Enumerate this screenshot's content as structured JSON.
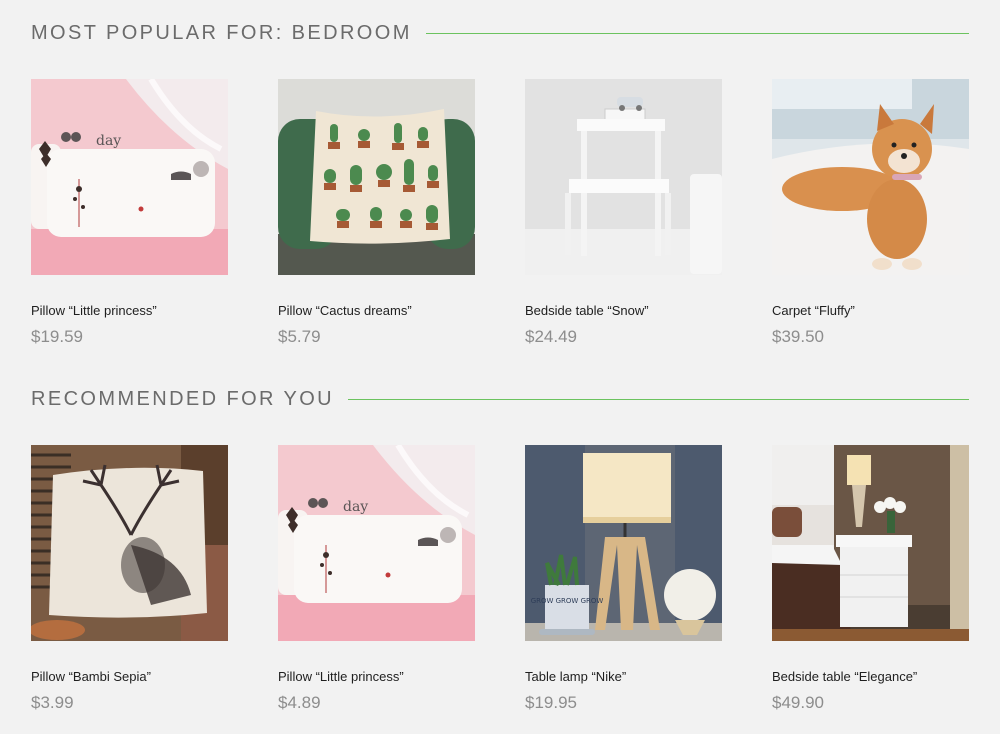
{
  "sections": [
    {
      "title": "MOST POPULAR FOR: BEDROOM",
      "products": [
        {
          "name": "Pillow “Little princess”",
          "price": "$19.59",
          "image": "pillow-princess-image"
        },
        {
          "name": "Pillow “Cactus dreams”",
          "price": "$5.79",
          "image": "pillow-cactus-image"
        },
        {
          "name": "Bedside table “Snow”",
          "price": "$24.49",
          "image": "bedside-snow-image"
        },
        {
          "name": "Carpet “Fluffy”",
          "price": "$39.50",
          "image": "carpet-fluffy-image"
        }
      ]
    },
    {
      "title": "RECOMMENDED FOR YOU",
      "products": [
        {
          "name": "Pillow “Bambi Sepia”",
          "price": "$3.99",
          "image": "pillow-bambi-image"
        },
        {
          "name": "Pillow “Little princess”",
          "price": "$4.89",
          "image": "pillow-princess-image"
        },
        {
          "name": "Table lamp “Nike”",
          "price": "$19.95",
          "image": "table-lamp-image"
        },
        {
          "name": "Bedside table “Elegance”",
          "price": "$49.90",
          "image": "bedside-elegance-image"
        }
      ]
    }
  ],
  "colors": {
    "accent_rule": "#6cc35f",
    "title_text": "#6b6b6b",
    "price_text": "#8d8d8d",
    "background": "#f2f2f2"
  },
  "image_text": {
    "pillow_day": "day",
    "lamp_pot": "GROW GROW GROW"
  }
}
